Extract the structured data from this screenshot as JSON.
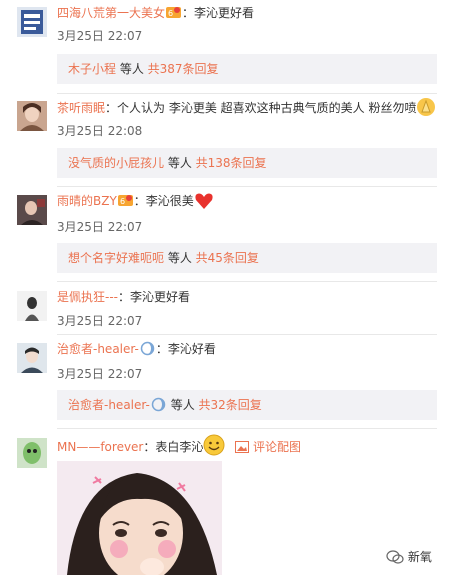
{
  "comments": [
    {
      "user": "四海八荒第一大美女",
      "text": "：李沁更好看",
      "time": "3月25日 22:07",
      "replies": {
        "name": "木子小程",
        "mid": " 等人 ",
        "count": "共387条回复"
      }
    },
    {
      "user": "茶听雨眠",
      "text": "：个人认为 李沁更美 超喜欢这种古典气质的美人 粉丝勿喷",
      "time": "3月25日 22:08",
      "replies": {
        "name": "没气质的小屁孩儿",
        "mid": " 等人 ",
        "count": "共138条回复"
      }
    },
    {
      "user": "雨晴的BZY",
      "text": "：李沁很美",
      "time": "3月25日 22:07",
      "replies": {
        "name": "想个名字好难呃呃",
        "mid": " 等人 ",
        "count": "共45条回复"
      }
    },
    {
      "user": "是佩执狂---",
      "text": "：李沁更好看",
      "time": "3月25日 22:07"
    },
    {
      "user": "治愈者-healer-",
      "text": "：李沁好看",
      "time": "3月25日 22:07",
      "replies": {
        "name": "治愈者-healer-",
        "mid": " 等人 ",
        "count": "共32条回复"
      }
    },
    {
      "user": "MN——forever",
      "text": "：表白李沁",
      "pic_link": "评论配图"
    }
  ],
  "watermark": "新氧",
  "colors": {
    "username": "#eb7350",
    "reply_bg": "#f2f2f5",
    "divider": "#e8e8e8"
  }
}
